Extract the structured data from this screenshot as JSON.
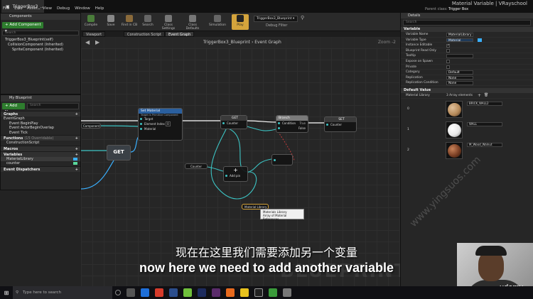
{
  "window": {
    "tab_label": "TriggerBox3_...",
    "title": "Material Variable  |  VRayschool",
    "parent_class_label": "Parent class:",
    "parent_class_value": "Trigger Box",
    "menus": [
      "File",
      "Edit",
      "Asset",
      "View",
      "Debug",
      "Window",
      "Help"
    ]
  },
  "components": {
    "header": "Components",
    "add_label": "+ Add Component ▾",
    "search_placeholder": "Search",
    "tree": [
      "TriggerBox3_Blueprint(self)",
      "CollisionComponent (Inherited)",
      "SpriteComponent (Inherited)"
    ]
  },
  "my_blueprint": {
    "header": "My Blueprint",
    "add_new": "+ Add New ▾",
    "search_placeholder": "Search",
    "graphs_label": "Graphs",
    "event_graph": "EventGraph",
    "events": [
      "Event BeginPlay",
      "Event ActorBeginOverlap",
      "Event Tick"
    ],
    "functions_label": "Functions",
    "functions_count": "(15 Overridable)",
    "functions": [
      "ConstructionScript"
    ],
    "macros_label": "Macros",
    "variables_label": "Variables",
    "variables": [
      "MaterialLibrary",
      "counter"
    ],
    "dispatchers_label": "Event Dispatchers"
  },
  "toolbar": {
    "buttons": [
      "Compile",
      "Save",
      "Find in CB",
      "Search",
      "Class Settings",
      "Class Defaults",
      "Simulation",
      "Play"
    ],
    "debug_selected": "TriggerBox3_Blueprint ▾",
    "debug_label": "Debug Filter"
  },
  "graph_tabs": [
    "Viewport",
    "Construction Script",
    "Event Graph"
  ],
  "graph": {
    "breadcrumb": "TriggerBox3_Blueprint  ›  Event Graph",
    "zoom": "Zoom -2",
    "nodes": {
      "set_material": {
        "title": "Set Material",
        "subtitle": "Target is Primitive Component",
        "pins": [
          "Target",
          "Element Index",
          "Material"
        ],
        "index_value": "0"
      },
      "get_big": {
        "title": "GET"
      },
      "get_small": {
        "title": "GET",
        "pins": [
          "Counter"
        ]
      },
      "branch": {
        "title": "Branch",
        "pins": [
          "Condition"
        ],
        "outputs": [
          "True",
          "False"
        ]
      },
      "set": {
        "title": "SET",
        "pins": [
          "Counter"
        ]
      },
      "counter_var": {
        "title": "Counter"
      },
      "add": {
        "title": "+",
        "pins": [
          "Add pin"
        ]
      },
      "material_library": {
        "title": "Material Library"
      },
      "component_ref": {
        "title": "Component"
      }
    },
    "tooltip_line1": "Materials Library",
    "tooltip_line2": "Array of Material References",
    "watermark": "BLUEPRINT"
  },
  "details": {
    "header": "Details",
    "search_placeholder": "Search",
    "variable_section": "Variable",
    "props": [
      {
        "label": "Variable Name",
        "value": "MaterialLibrary",
        "type": "text"
      },
      {
        "label": "Variable Type",
        "value": "Material",
        "type": "text"
      },
      {
        "label": "Instance Editable",
        "type": "check",
        "on": true
      },
      {
        "label": "Blueprint Read Only",
        "type": "check",
        "on": false
      },
      {
        "label": "Tooltip",
        "type": "text",
        "value": ""
      },
      {
        "label": "Expose on Spawn",
        "type": "check",
        "on": false
      },
      {
        "label": "Private",
        "type": "check",
        "on": false
      },
      {
        "label": "Category",
        "value": "Default",
        "type": "text"
      },
      {
        "label": "Replication",
        "value": "None",
        "type": "text"
      },
      {
        "label": "Replication Condition",
        "value": "None",
        "type": "text"
      }
    ],
    "default_section": "Default Value",
    "library_label": "Material Library",
    "library_count": "3 Array elements",
    "elements": [
      {
        "index": "0",
        "material": "BRICK_WALL2",
        "color": "#b68a5a"
      },
      {
        "index": "1",
        "material": "WALL",
        "color": "#e8e8e8"
      },
      {
        "index": "2",
        "material": "M_Wood_Walnut",
        "color": "#7a3f24"
      }
    ]
  },
  "subtitles": {
    "zh": "现在在这里我们需要添加另一个变量",
    "en": "now here we need to add another variable",
    "site": "www.yingsuos.com"
  },
  "webcam": {
    "brand": "udemy"
  },
  "taskbar": {
    "search_placeholder": "Type here to search"
  },
  "colors": {
    "add_button": "#2e7d2e",
    "exec_wire": "#ffffff",
    "data_wire": "#3cc3c3",
    "material_pin": "#3ab0ff",
    "node_header_blue": "#2a5f9e",
    "branch_header": "#7a7a7a",
    "error_wire": "#c23b3b"
  }
}
